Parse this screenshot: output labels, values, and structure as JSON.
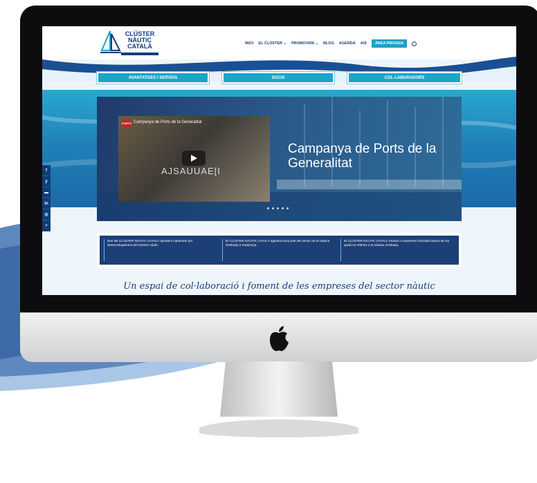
{
  "logo": {
    "line1": "CLÚSTER",
    "line2": "NÀUTIC",
    "line3": "CATALÀ"
  },
  "nav": {
    "items": [
      "INICI",
      "EL CLÚSTER ⌄",
      "PROMOVEM ⌄",
      "BLOG",
      "AGENDA",
      "AIS"
    ],
    "private": "ÀREA PRIVADA"
  },
  "tabs": [
    "AVANTATGES I SERVEIS",
    "SOCIS",
    "COL·LABORADORS"
  ],
  "hero": {
    "title": "Campanya de Ports de la Generalitat",
    "video_title": "Campanya de Ports de la Generalitat",
    "video_caption": "AJSAUUAE[I"
  },
  "social": [
    "f",
    "y",
    "▬",
    "in",
    "◎",
    "+"
  ],
  "info": [
    "Des del CLÚSTER NÀUTIC CATALÀ apostem clarament pel desenvolupament del turisme nàutic.",
    "El CLÚSTER NÀUTIC CATALÀ aglutina bona part del sector de la nàutica d'esbarjo a Catalunya.",
    "El CLÚSTER NÀUTIC CATALÀ reuneix a empreses l'activitat bàsica de les quals es refereix a la nàutica d'esbarjo."
  ],
  "slogan": "Un espai de col·laboració i foment de les empreses del sector nàutic",
  "colors": {
    "navy": "#0f3d7a",
    "accent": "#1aa6c9"
  }
}
